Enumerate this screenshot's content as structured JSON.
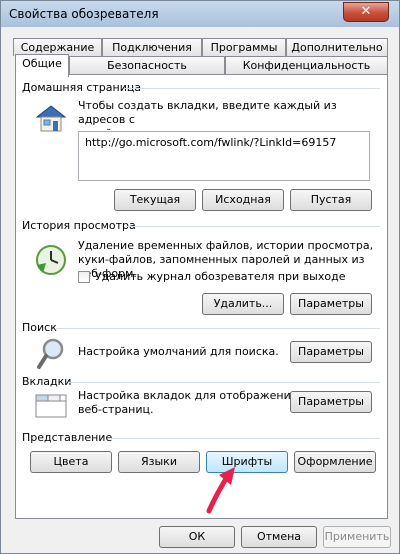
{
  "window": {
    "title": "Свойства обозревателя",
    "close_glyph": "✕"
  },
  "tabs": {
    "row1": [
      "Содержание",
      "Подключения",
      "Программы",
      "Дополнительно"
    ],
    "row2": [
      "Общие",
      "Безопасность",
      "Конфиденциальность"
    ]
  },
  "home": {
    "title": "Домашняя страница",
    "description": [
      "Чтобы создать вкладки, введите каждый из адресов с",
      "новой строки."
    ],
    "url": "http://go.microsoft.com/fwlink/?LinkId=69157",
    "buttons": [
      "Текущая",
      "Исходная",
      "Пустая"
    ]
  },
  "history": {
    "title": "История просмотра",
    "description": [
      "Удаление временных файлов, истории просмотра,",
      "куки-файлов, запомненных паролей и данных из веб-форм."
    ],
    "checkbox_label": "Удалить журнал обозревателя при выходе",
    "delete_button": "Удалить...",
    "settings_button": "Параметры"
  },
  "search": {
    "title": "Поиск",
    "description": "Настройка умолчаний для поиска.",
    "settings_button": "Параметры"
  },
  "tabs_section": {
    "title": "Вкладки",
    "description": [
      "Настройка вкладок для отображения",
      "веб-страниц."
    ],
    "settings_button": "Параметры"
  },
  "appearance": {
    "title": "Представление",
    "buttons": [
      "Цвета",
      "Языки",
      "Шрифты",
      "Оформление"
    ]
  },
  "footer": {
    "ok": "ОК",
    "cancel": "Отмена",
    "apply": "Применить"
  },
  "colors": {
    "annotation_arrow": "#e8204a",
    "close_button": "#c7503c"
  }
}
